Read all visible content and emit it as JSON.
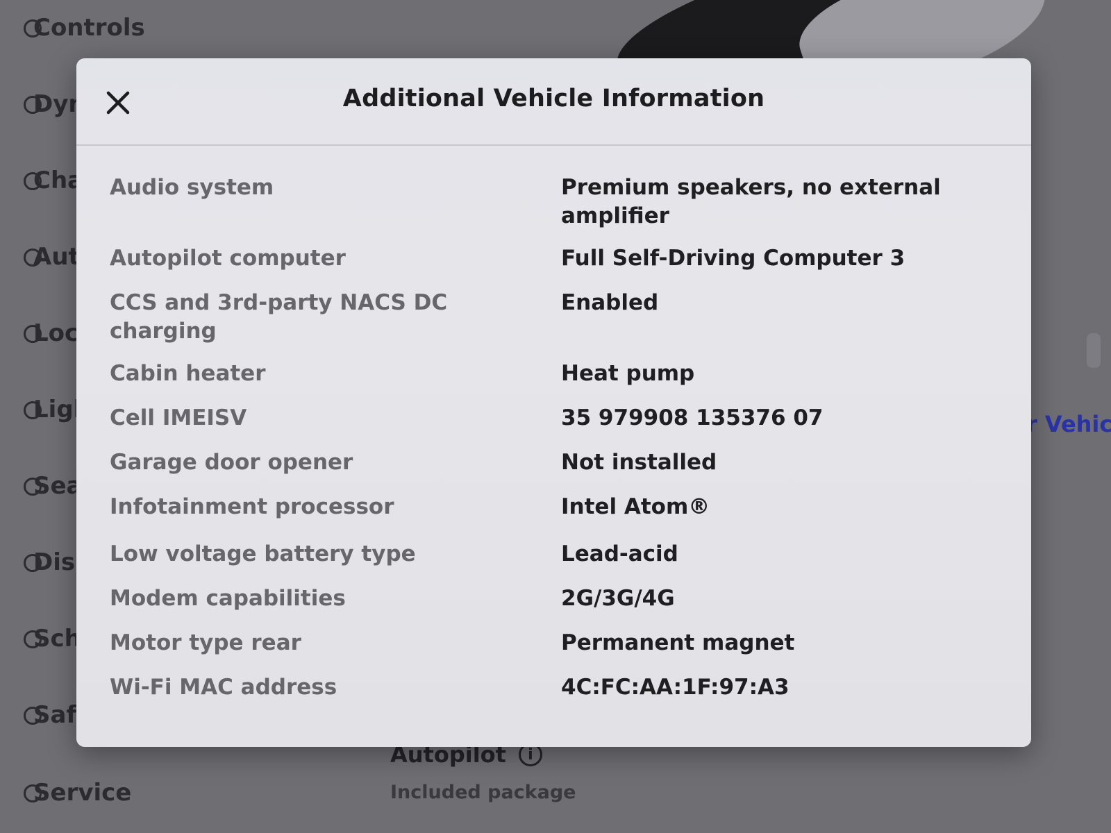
{
  "background": {
    "sidebar_items": [
      {
        "label": "Controls",
        "icon": "toggle-icon"
      },
      {
        "label": "Dyn",
        "icon": "car-icon"
      },
      {
        "label": "Cha",
        "icon": "charging-icon"
      },
      {
        "label": "Aut",
        "icon": "steering-wheel-icon"
      },
      {
        "label": "Loc",
        "icon": "lock-icon"
      },
      {
        "label": "Ligl",
        "icon": "light-icon"
      },
      {
        "label": "Sea",
        "icon": "seat-icon"
      },
      {
        "label": "Dis",
        "icon": "display-icon"
      },
      {
        "label": "Sch",
        "icon": "clock-icon"
      },
      {
        "label": "Saf",
        "icon": "safety-icon"
      },
      {
        "label": "Service",
        "icon": "wrench-icon"
      }
    ],
    "link_text": "r Vehic",
    "autopilot_label": "Autopilot",
    "autopilot_info_glyph": "i",
    "autopilot_subtext": "Included package"
  },
  "modal": {
    "title": "Additional Vehicle Information",
    "close_icon": "close-icon",
    "rows": [
      {
        "label": "Audio system",
        "value": "Premium speakers, no external amplifier"
      },
      {
        "label": "Autopilot computer",
        "value": "Full Self-Driving Computer 3"
      },
      {
        "label": "CCS and 3rd-party NACS DC charging",
        "value": "Enabled"
      },
      {
        "label": "Cabin heater",
        "value": "Heat pump"
      },
      {
        "label": "Cell IMEISV",
        "value": "35 979908 135376 07"
      },
      {
        "label": "Garage door opener",
        "value": "Not installed"
      },
      {
        "label": "Infotainment processor",
        "value": "Intel Atom®"
      },
      {
        "label": "Low voltage battery type",
        "value": "Lead-acid"
      },
      {
        "label": "Modem capabilities",
        "value": "2G/3G/4G"
      },
      {
        "label": "Motor type rear",
        "value": "Permanent magnet"
      },
      {
        "label": "Wi-Fi MAC address",
        "value": "4C:FC:AA:1F:97:A3"
      }
    ]
  }
}
